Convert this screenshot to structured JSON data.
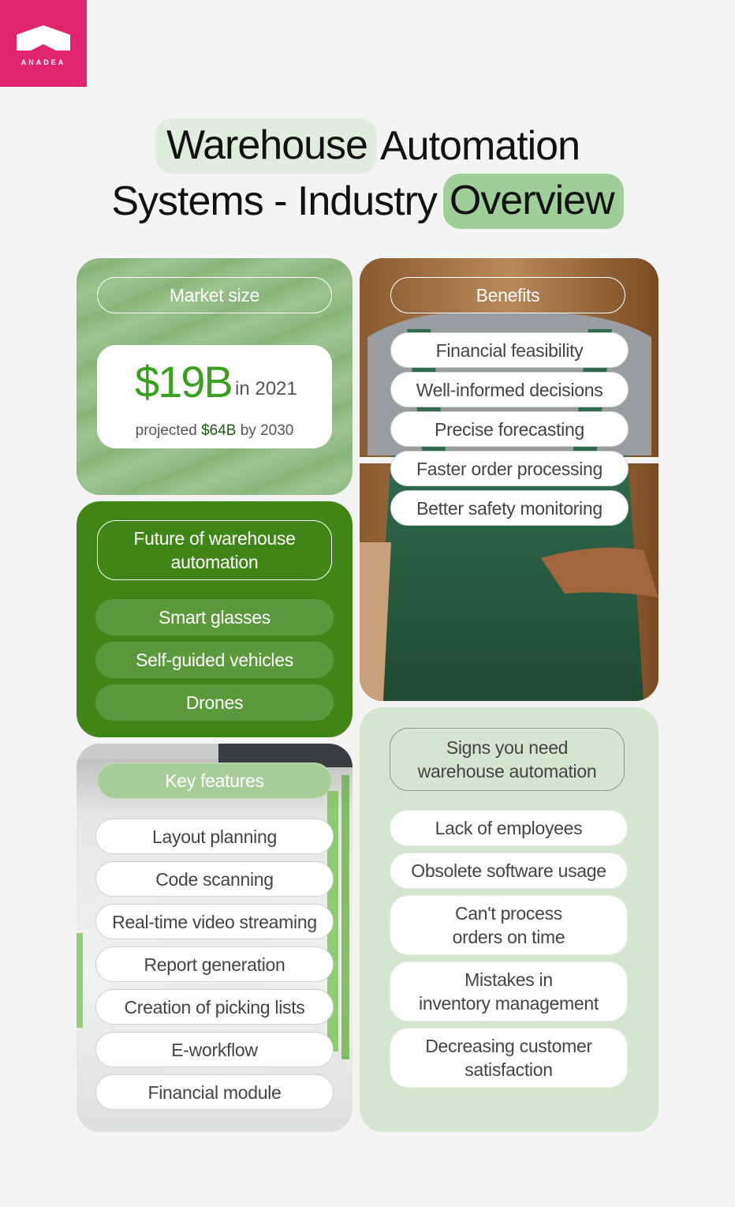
{
  "logo": {
    "text": "ANADEA"
  },
  "title": {
    "w1": "Warehouse",
    "w2": "Automation",
    "w3": "Systems - Industry",
    "w4": "Overview"
  },
  "market": {
    "label": "Market size",
    "value": "$19B",
    "year": "in 2021",
    "projected_prefix": "projected",
    "projected_value": "$64B",
    "projected_suffix": "by 2030"
  },
  "benefits": {
    "label": "Benefits",
    "items": [
      "Financial feasibility",
      "Well-informed decisions",
      "Precise forecasting",
      "Faster order processing",
      "Better safety monitoring"
    ]
  },
  "future": {
    "label_line1": "Future of warehouse",
    "label_line2": "automation",
    "items": [
      "Smart glasses",
      "Self-guided vehicles",
      "Drones"
    ]
  },
  "features": {
    "label": "Key features",
    "items": [
      "Layout planning",
      "Code scanning",
      "Real-time video streaming",
      "Report generation",
      "Creation of picking lists",
      "E-workflow",
      "Financial module"
    ]
  },
  "signs": {
    "label_line1": "Signs you need",
    "label_line2": "warehouse automation",
    "items": [
      {
        "l1": "Lack of employees",
        "l2": ""
      },
      {
        "l1": "Obsolete software usage",
        "l2": ""
      },
      {
        "l1": "Can't process",
        "l2": "orders on time"
      },
      {
        "l1": "Mistakes in",
        "l2": "inventory management"
      },
      {
        "l1": "Decreasing customer",
        "l2": "satisfaction"
      }
    ]
  },
  "colors": {
    "brand": "#e0246e",
    "accent_green": "#3aa020",
    "dark_green": "#3f8616",
    "light_green": "#d4e5d0"
  }
}
